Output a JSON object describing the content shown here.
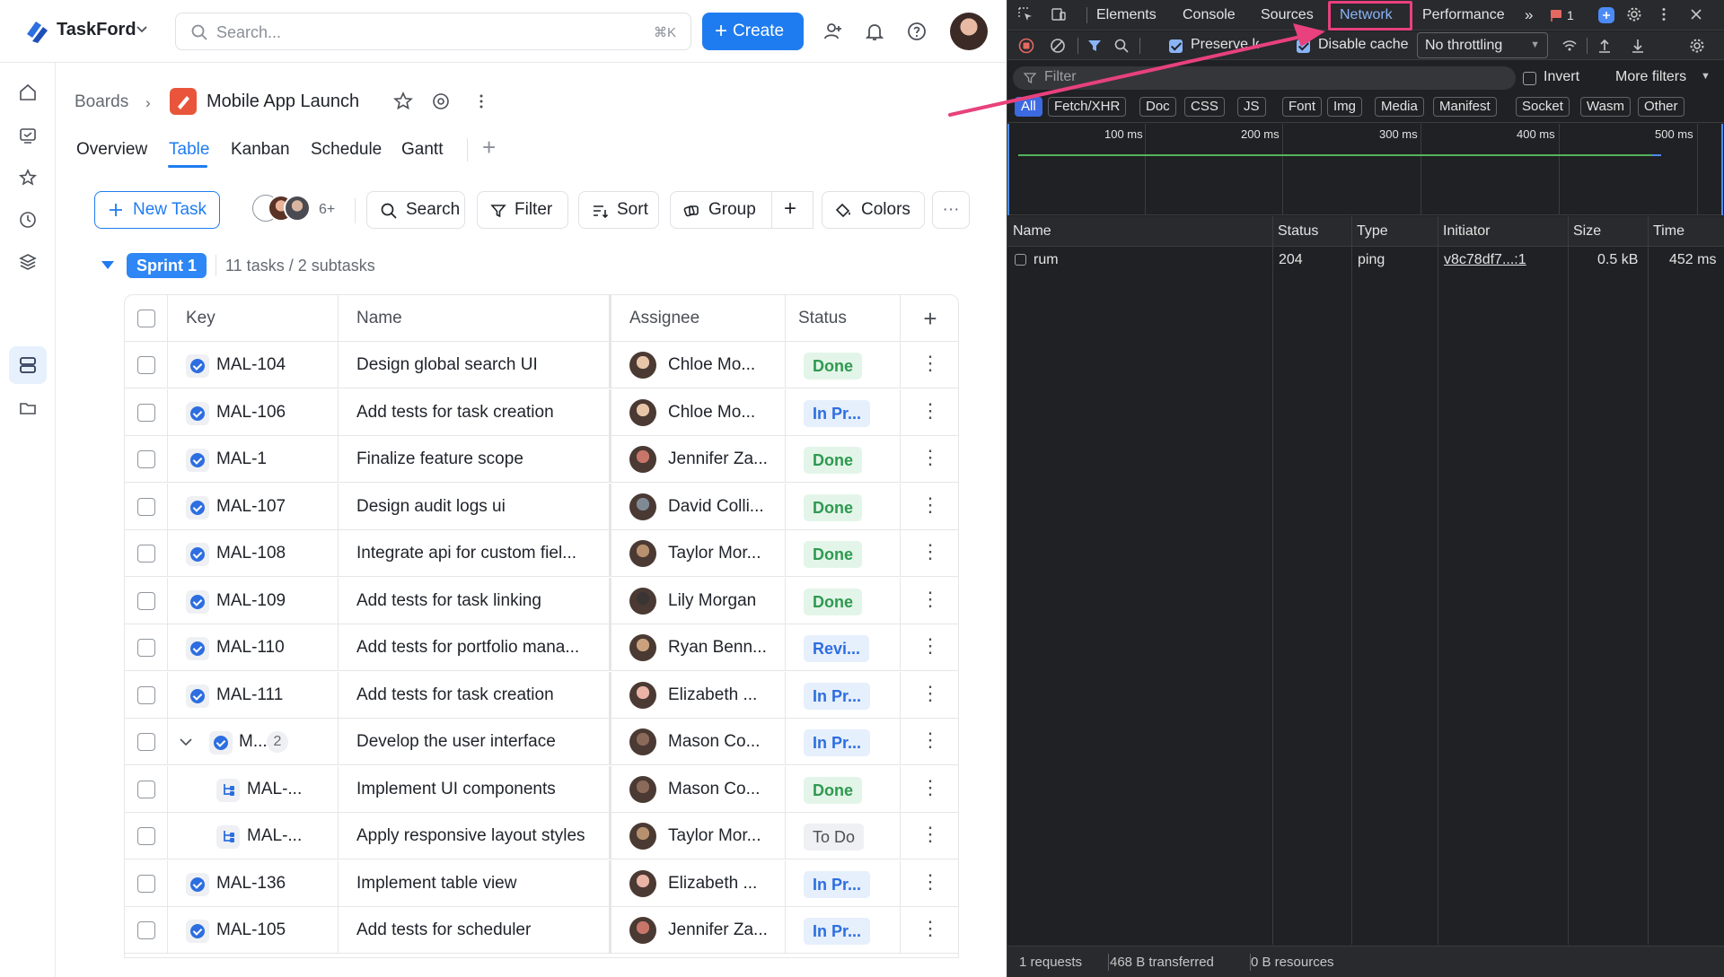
{
  "topbar": {
    "brand": "TaskFord",
    "search_placeholder": "Search...",
    "search_shortcut": "⌘K",
    "create_label": "Create",
    "brand_color": "#1f7cf0"
  },
  "breadcrumb": {
    "root": "Boards",
    "project": "Mobile App Launch"
  },
  "tabs": [
    "Overview",
    "Table",
    "Kanban",
    "Schedule",
    "Gantt"
  ],
  "active_tab": "Table",
  "toolbar": {
    "new_task": "New Task",
    "avatar_more": "6+",
    "search": "Search",
    "filter": "Filter",
    "sort": "Sort",
    "group": "Group",
    "colors": "Colors"
  },
  "sprint": {
    "name": "Sprint 1",
    "info": "11 tasks / 2 subtasks"
  },
  "table": {
    "headers": {
      "key": "Key",
      "name": "Name",
      "assignee": "Assignee",
      "status": "Status"
    },
    "rows": [
      {
        "key": "MAL-104",
        "name": "Design global search UI",
        "assignee": "Chloe Mo...",
        "status": "Done",
        "kind": "task"
      },
      {
        "key": "MAL-106",
        "name": "Add tests for task creation",
        "assignee": "Chloe Mo...",
        "status": "In Pr...",
        "kind": "task"
      },
      {
        "key": "MAL-1",
        "name": "Finalize feature scope",
        "assignee": "Jennifer Za...",
        "status": "Done",
        "kind": "task"
      },
      {
        "key": "MAL-107",
        "name": "Design audit logs ui",
        "assignee": "David Colli...",
        "status": "Done",
        "kind": "task"
      },
      {
        "key": "MAL-108",
        "name": "Integrate api for custom fiel...",
        "assignee": "Taylor Mor...",
        "status": "Done",
        "kind": "task"
      },
      {
        "key": "MAL-109",
        "name": "Add tests for task linking",
        "assignee": "Lily Morgan",
        "status": "Done",
        "kind": "task"
      },
      {
        "key": "MAL-110",
        "name": "Add tests for portfolio mana...",
        "assignee": "Ryan Benn...",
        "status": "Revi...",
        "kind": "task"
      },
      {
        "key": "MAL-111",
        "name": "Add tests for task creation",
        "assignee": "Elizabeth ...",
        "status": "In Pr...",
        "kind": "task"
      },
      {
        "key": "M...",
        "name": "Develop the user interface",
        "assignee": "Mason Co...",
        "status": "In Pr...",
        "kind": "parent",
        "sub_count": "2"
      },
      {
        "key": "MAL-...",
        "name": "Implement UI components",
        "assignee": "Mason Co...",
        "status": "Done",
        "kind": "subtask"
      },
      {
        "key": "MAL-...",
        "name": "Apply responsive layout styles",
        "assignee": "Taylor Mor...",
        "status": "To Do",
        "kind": "subtask"
      },
      {
        "key": "MAL-136",
        "name": "Implement table view",
        "assignee": "Elizabeth ...",
        "status": "In Pr...",
        "kind": "task"
      },
      {
        "key": "MAL-105",
        "name": "Add tests for scheduler",
        "assignee": "Jennifer Za...",
        "status": "In Pr...",
        "kind": "task"
      }
    ]
  },
  "devtools": {
    "tabs": [
      "Elements",
      "Console",
      "Sources",
      "Network",
      "Performance"
    ],
    "active_tab": "Network",
    "issues_count": "1",
    "preserve_log": "Preserve log",
    "disable_cache": "Disable cache",
    "throttling": "No throttling",
    "filter_placeholder": "Filter",
    "invert": "Invert",
    "more_filters": "More filters",
    "chips": [
      "All",
      "Fetch/XHR",
      "Doc",
      "CSS",
      "JS",
      "Font",
      "Img",
      "Media",
      "Manifest",
      "Socket",
      "Wasm",
      "Other"
    ],
    "timeline_labels": [
      "100 ms",
      "200 ms",
      "300 ms",
      "400 ms",
      "500 ms"
    ],
    "columns": [
      "Name",
      "Status",
      "Type",
      "Initiator",
      "Size",
      "Time"
    ],
    "requests": [
      {
        "name": "rum",
        "status": "204",
        "type": "ping",
        "initiator": "v8c78df7...:1",
        "size": "0.5 kB",
        "time": "452 ms"
      }
    ],
    "summary": {
      "requests": "1 requests",
      "transferred": "468 B transferred",
      "resources": "0 B resources"
    },
    "highlight_color": "#e8417c"
  }
}
